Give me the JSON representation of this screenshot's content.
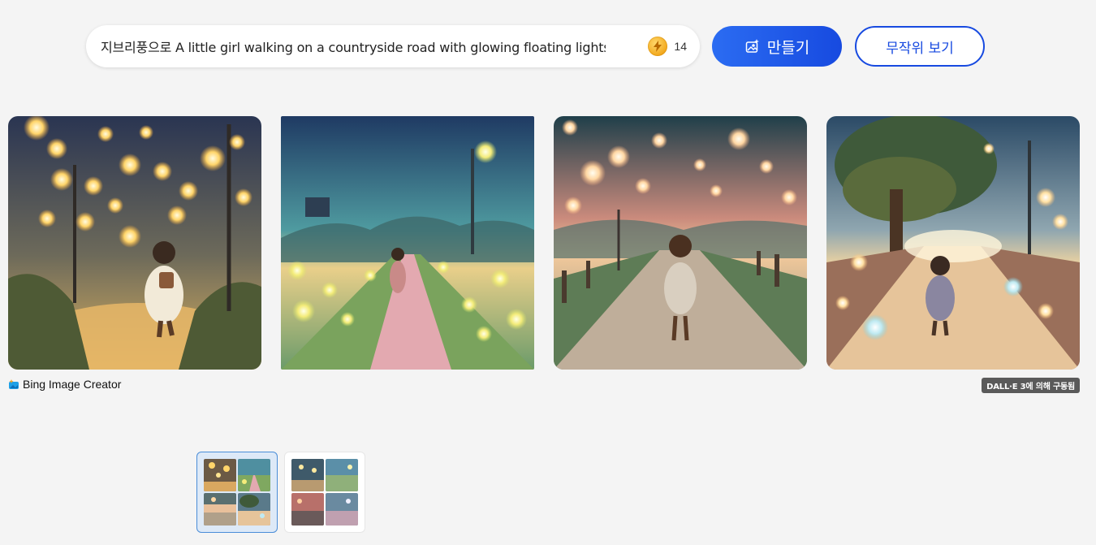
{
  "prompt": {
    "text": "지브리풍으로 A little girl walking on a countryside road with glowing floating lights, soft w",
    "boosts_remaining": "14"
  },
  "buttons": {
    "create_label": "만들기",
    "surprise_label": "무작위 보기"
  },
  "results": {
    "creator_label": "Bing Image Creator",
    "powered_by": "DALL·E 3에 의해 구동됨"
  },
  "colors": {
    "accent": "#174ae0",
    "page_bg": "#f4f4f4",
    "badge_bg": "#5a5a5a"
  },
  "icons": {
    "boost": "lightning-coin-icon",
    "create": "image-sparkle-icon",
    "creator": "bing-creator-icon"
  }
}
